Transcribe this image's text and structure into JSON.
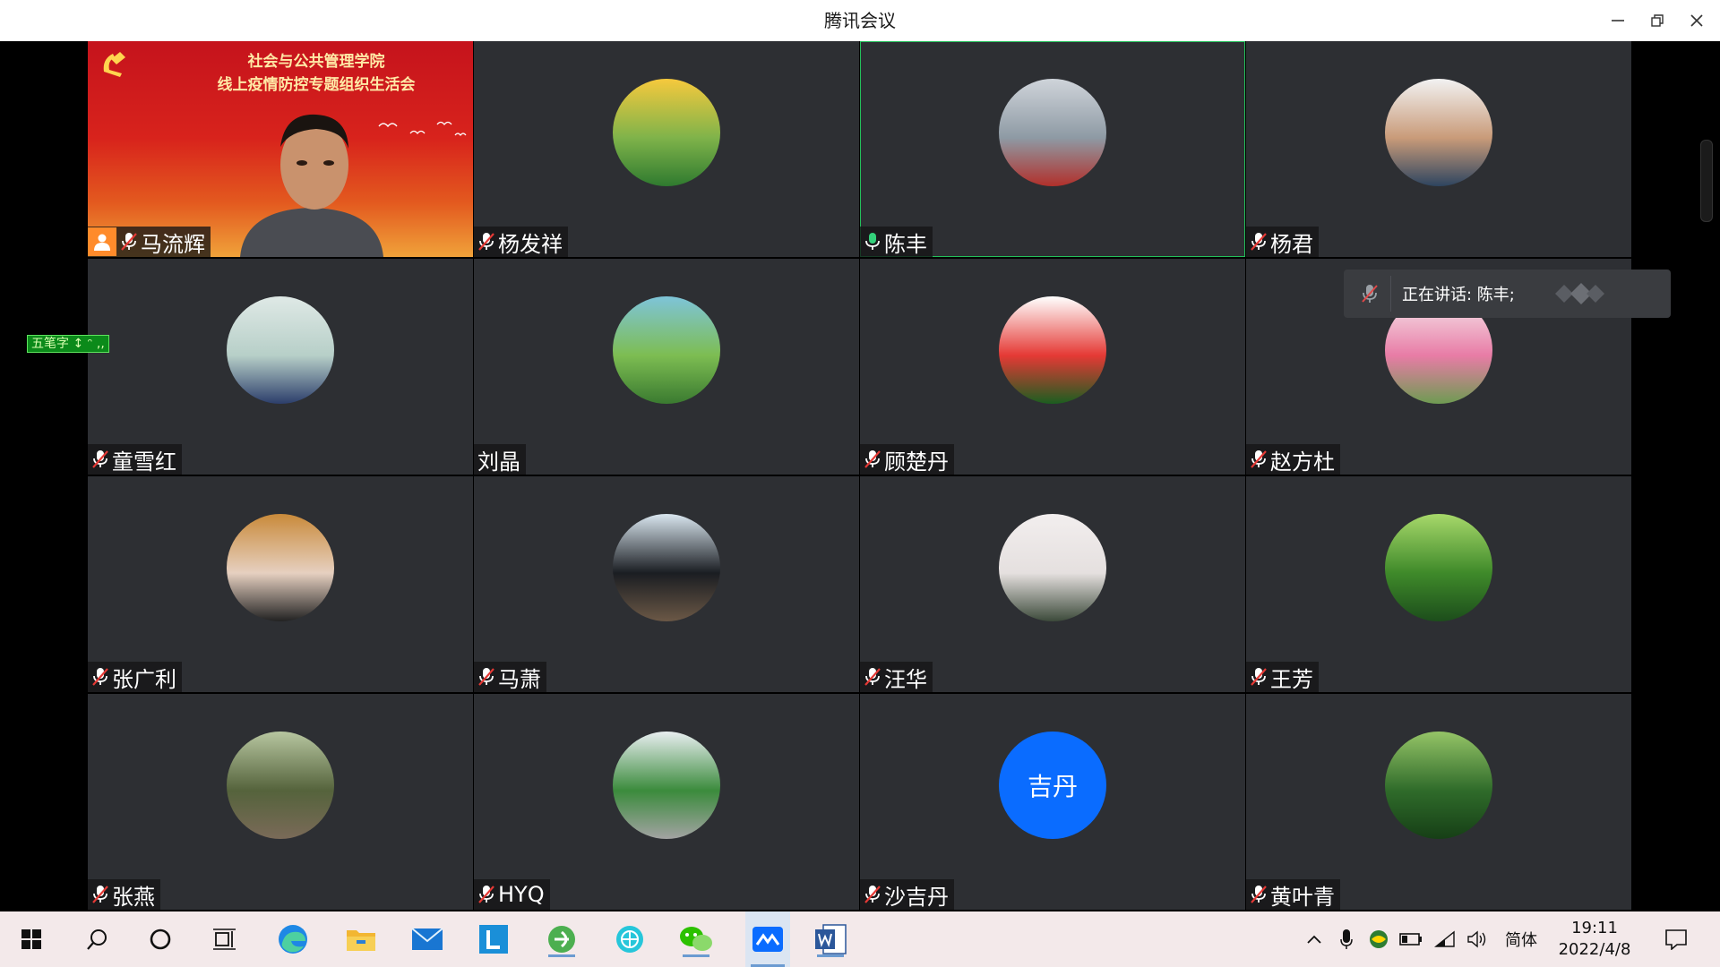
{
  "window": {
    "title": "腾讯会议"
  },
  "participants": [
    {
      "name": "马流辉",
      "muted": true,
      "host": true,
      "kind": "video"
    },
    {
      "name": "杨发祥",
      "muted": true,
      "kind": "avatar",
      "colors": [
        "#f6c93d",
        "#7fb34a",
        "#2f7a2f"
      ]
    },
    {
      "name": "陈丰",
      "muted": false,
      "speaking": true,
      "kind": "avatar",
      "colors": [
        "#cfd4da",
        "#8e9aa4",
        "#b1302b"
      ]
    },
    {
      "name": "杨君",
      "muted": true,
      "kind": "avatar",
      "colors": [
        "#f2f2f2",
        "#c99b79",
        "#2e4560"
      ]
    },
    {
      "name": "童雪红",
      "muted": true,
      "kind": "avatar",
      "colors": [
        "#dfe9e6",
        "#b7cfc8",
        "#2c3e6b"
      ]
    },
    {
      "name": "刘晶",
      "muted": null,
      "kind": "avatar",
      "colors": [
        "#7ec4d9",
        "#7dbd52",
        "#3a7a30"
      ]
    },
    {
      "name": "顾楚丹",
      "muted": true,
      "kind": "avatar",
      "colors": [
        "#ffffff",
        "#e53935",
        "#1b5e20"
      ]
    },
    {
      "name": "赵方杜",
      "muted": true,
      "kind": "avatar",
      "colors": [
        "#f6e8ec",
        "#e87ca6",
        "#6e9b52"
      ]
    },
    {
      "name": "张广利",
      "muted": true,
      "kind": "avatar",
      "colors": [
        "#c98a3a",
        "#e6d0c0",
        "#222222"
      ]
    },
    {
      "name": "马萧",
      "muted": true,
      "kind": "avatar",
      "colors": [
        "#d9e6ef",
        "#1a1d22",
        "#6b5846"
      ]
    },
    {
      "name": "汪华",
      "muted": true,
      "kind": "avatar",
      "colors": [
        "#f2eeee",
        "#e5e0df",
        "#3c4a3a"
      ]
    },
    {
      "name": "王芳",
      "muted": true,
      "kind": "avatar",
      "colors": [
        "#a7d86a",
        "#3f8a2a",
        "#1c4d1b"
      ]
    },
    {
      "name": "张燕",
      "muted": true,
      "kind": "avatar",
      "colors": [
        "#b7c6a0",
        "#55633c",
        "#7a6a58"
      ]
    },
    {
      "name": "HYQ",
      "muted": true,
      "kind": "avatar",
      "colors": [
        "#e8eef0",
        "#3b8b3c",
        "#a3a3a3"
      ]
    },
    {
      "name": "沙吉丹",
      "muted": true,
      "kind": "letter",
      "avatar_text": "吉丹",
      "color": "#0a6cff"
    },
    {
      "name": "黄叶青",
      "muted": true,
      "kind": "avatar",
      "colors": [
        "#95c467",
        "#2f6b2a",
        "#163f16"
      ]
    }
  ],
  "video_banner": {
    "line1": "社会与公共管理学院",
    "line2": "线上疫情防控专题组织生活会"
  },
  "toast": {
    "label": "正在讲话: 陈丰;"
  },
  "ime_float": {
    "text": "五笔字 ↕ ᵔ ,,"
  },
  "taskbar": {
    "ime_label": "简体",
    "time": "19:11",
    "date": "2022/4/8"
  }
}
